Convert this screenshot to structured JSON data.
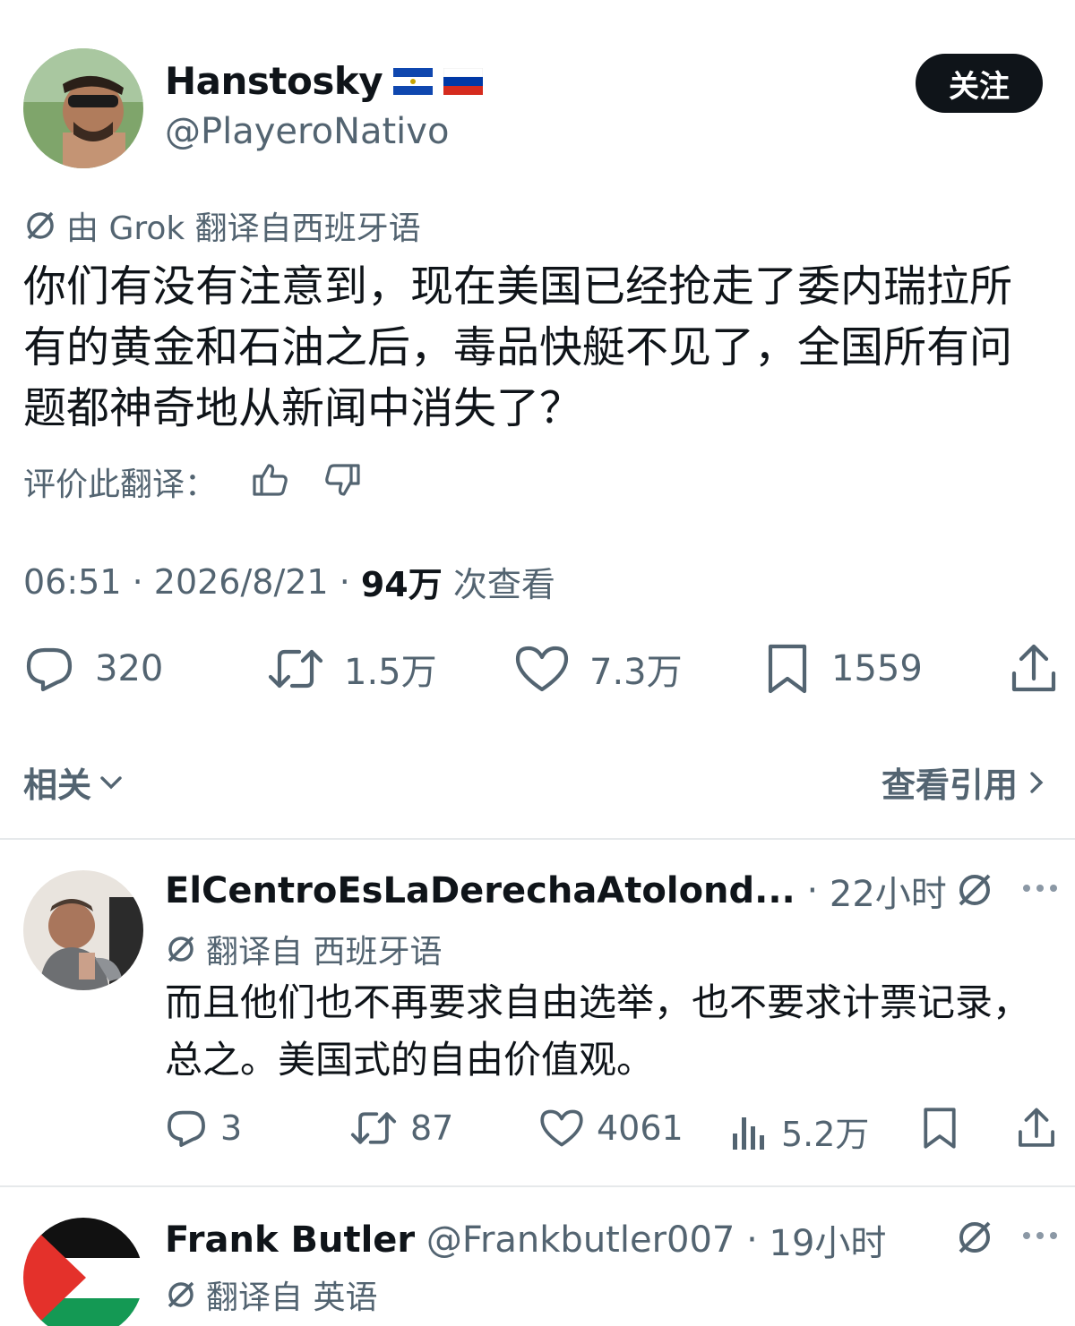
{
  "main_tweet": {
    "author_name": "Hanstosky",
    "author_flags": [
      "🇸🇻",
      "🇷🇺"
    ],
    "author_handle": "@PlayeroNativo",
    "follow_label": "关注",
    "translation_note": "由 Grok 翻译自西班牙语",
    "text": "你们有没有注意到，现在美国已经抢走了委内瑞拉所有的黄金和石油之后，毒品快艇不见了，全国所有问题都神奇地从新闻中消失了？",
    "rate_label": "评价此翻译：",
    "time": "06:51",
    "date": "2026/8/21",
    "views_count": "94万",
    "views_label": "次查看",
    "actions": {
      "replies": "320",
      "retweets": "1.5万",
      "likes": "7.3万",
      "bookmarks": "1559"
    },
    "related_label": "相关",
    "quotes_label": "查看引用"
  },
  "replies": [
    {
      "author_name": "ElCentroEsLaDerechaAtolond...",
      "time": "22小时",
      "translation_note": "翻译自 西班牙语",
      "text": "而且他们也不再要求自由选举，也不要求计票记录，总之。美国式的自由价值观。",
      "actions": {
        "replies": "3",
        "retweets": "87",
        "likes": "4061",
        "views": "5.2万"
      }
    },
    {
      "author_name": "Frank Butler",
      "author_handle": "@Frankbutler007",
      "time": "19小时",
      "translation_note": "翻译自 英语"
    }
  ],
  "colors": {
    "text_primary": "#0f1419",
    "text_secondary": "#536471",
    "button_bg": "#0f1419",
    "divider": "#e6e9eb"
  },
  "icons": [
    "grok-icon",
    "thumbs-up-icon",
    "thumbs-down-icon",
    "reply-icon",
    "retweet-icon",
    "heart-icon",
    "bookmark-icon",
    "share-icon",
    "chevron-down-icon",
    "chevron-right-icon",
    "views-icon",
    "more-icon"
  ]
}
